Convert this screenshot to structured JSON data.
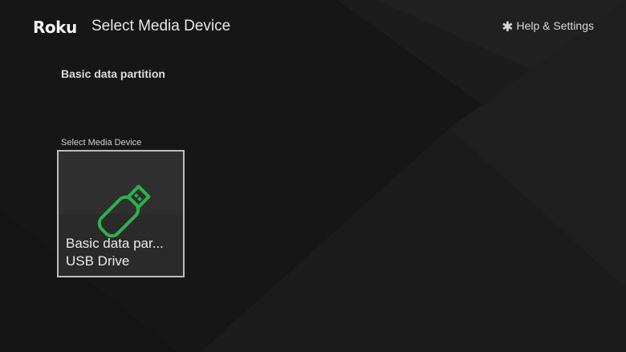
{
  "header": {
    "logo": "Roku",
    "title": "Select Media Device",
    "help_label": "Help & Settings",
    "help_icon": "asterisk-icon"
  },
  "main": {
    "subtitle": "Basic data partition",
    "section_label": "Select Media Device",
    "devices": [
      {
        "name": "Basic data par...",
        "type": "USB Drive",
        "icon": "usb-drive-icon",
        "icon_color": "#2bb34a",
        "selected": true
      }
    ]
  }
}
